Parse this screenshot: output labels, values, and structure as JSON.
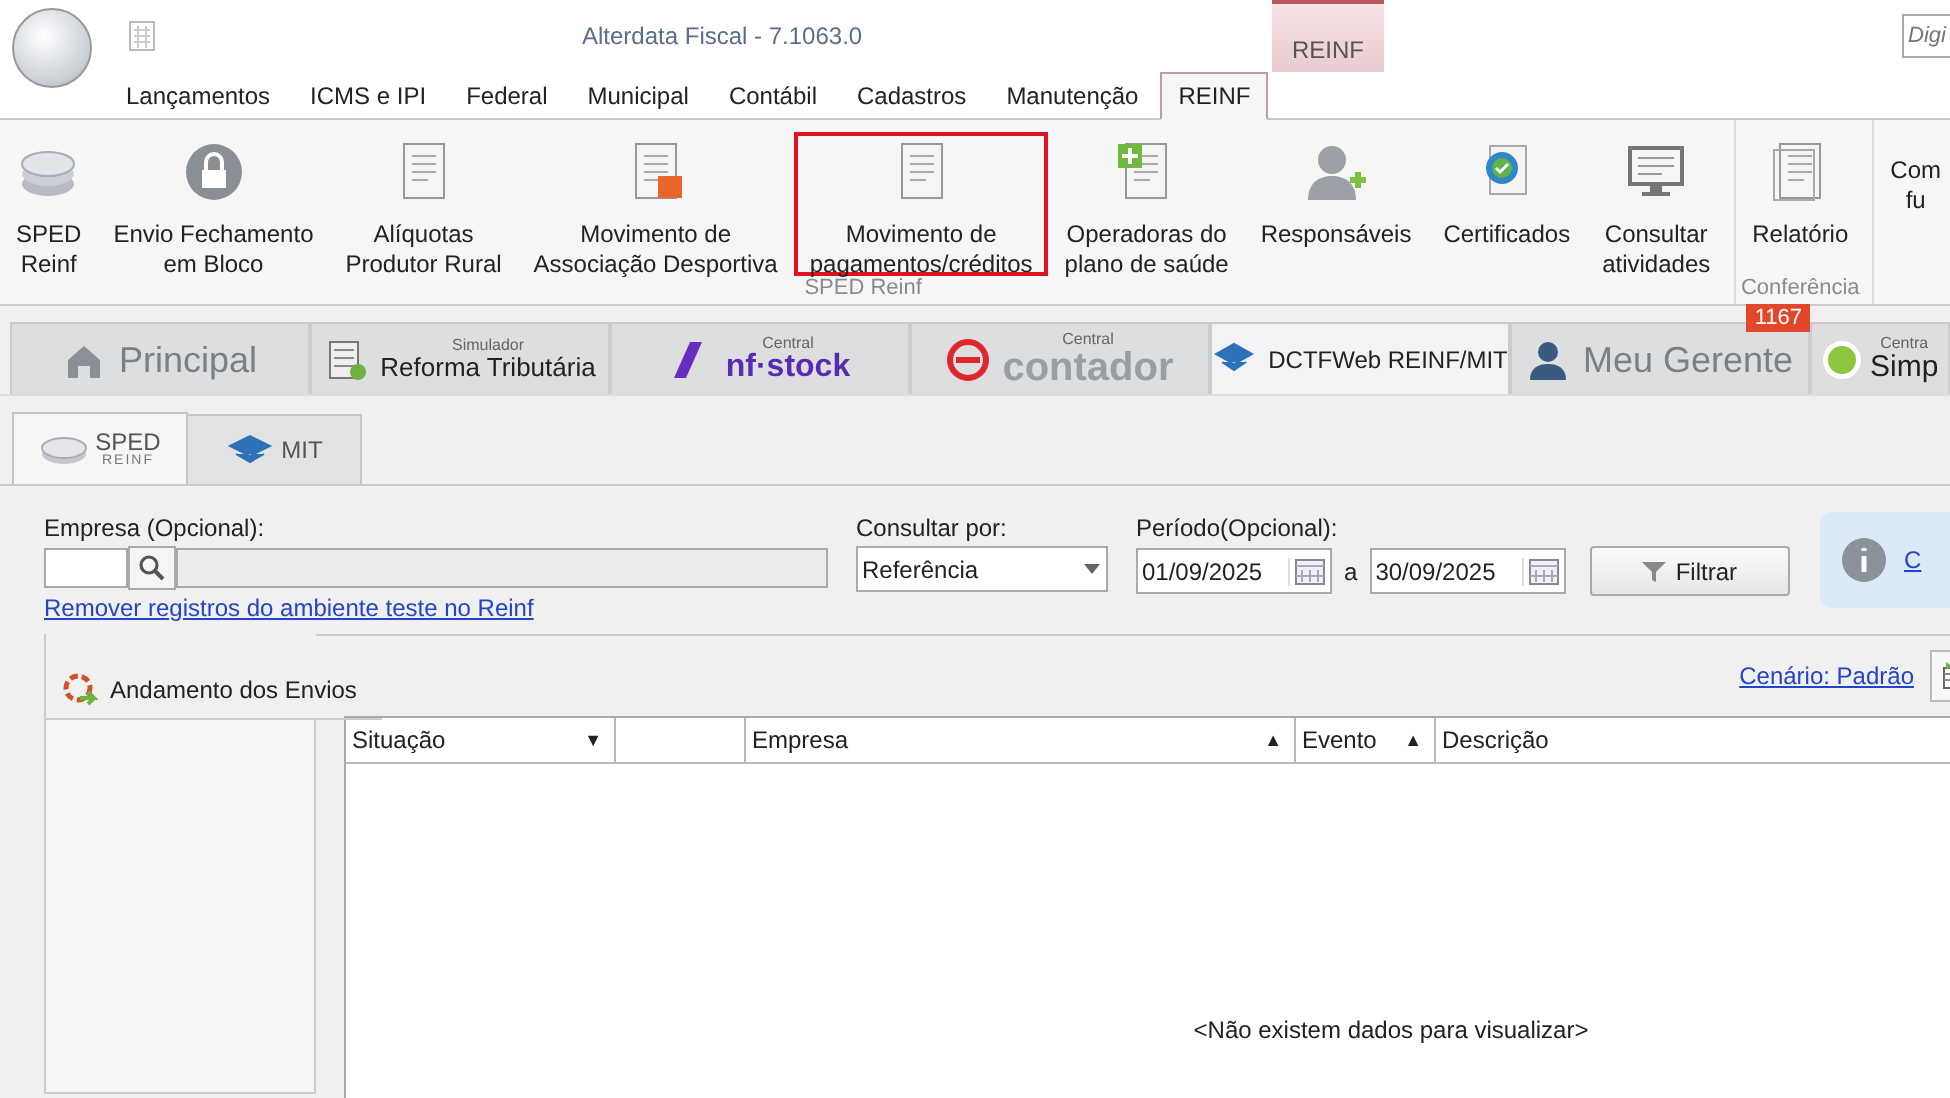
{
  "window": {
    "title": "Alterdata Fiscal - 7.1063.0",
    "context_tab": "REINF",
    "search_placeholder": "Digi"
  },
  "menu_tabs": [
    {
      "label": "Lançamentos",
      "selected": false
    },
    {
      "label": "ICMS e IPI",
      "selected": false
    },
    {
      "label": "Federal",
      "selected": false
    },
    {
      "label": "Municipal",
      "selected": false
    },
    {
      "label": "Contábil",
      "selected": false
    },
    {
      "label": "Cadastros",
      "selected": false
    },
    {
      "label": "Manutenção",
      "selected": false
    },
    {
      "label": "REINF",
      "selected": true
    }
  ],
  "ribbon": {
    "groups": [
      {
        "label": "SPED Reinf",
        "buttons": [
          {
            "kind": "disks",
            "label": [
              "SPED",
              "Reinf"
            ],
            "highlighted": false
          },
          {
            "kind": "lock",
            "label": [
              "Envio Fechamento",
              "em Bloco"
            ],
            "highlighted": false
          },
          {
            "kind": "doc",
            "label": [
              "Alíquotas",
              "Produtor Rural"
            ],
            "highlighted": false
          },
          {
            "kind": "doc-arrows",
            "label": [
              "Movimento de",
              "Associação Desportiva"
            ],
            "highlighted": false
          },
          {
            "kind": "doc-list",
            "label": [
              "Movimento de",
              "pagamentos/créditos"
            ],
            "highlighted": true
          },
          {
            "kind": "doc-plus",
            "label": [
              "Operadoras do",
              "plano de saúde"
            ],
            "highlighted": false
          },
          {
            "kind": "person-plus",
            "label": [
              "Responsáveis"
            ],
            "highlighted": false
          },
          {
            "kind": "certificate",
            "label": [
              "Certificados"
            ],
            "highlighted": false
          },
          {
            "kind": "monitor",
            "label": [
              "Consultar",
              "atividades"
            ],
            "highlighted": false
          }
        ]
      },
      {
        "label": "Conferência",
        "buttons": [
          {
            "kind": "docs",
            "label": [
              "Relatório"
            ],
            "highlighted": false
          }
        ]
      },
      {
        "buttons": [
          {
            "kind": "none",
            "label": [
              "Com",
              "fu"
            ],
            "highlighted": false
          }
        ]
      }
    ]
  },
  "main_tabs": [
    {
      "kind": "home",
      "label": "Principal",
      "selected": false
    },
    {
      "kind": "calculator",
      "small": "Simulador",
      "label": "Reforma Tributária",
      "selected": false
    },
    {
      "kind": "nfstock",
      "small": "Central",
      "label": "nf·stock",
      "selected": false
    },
    {
      "kind": "contador",
      "small": "Central",
      "label": "contador",
      "selected": false
    },
    {
      "kind": "diamond",
      "label": "DCTFWeb REINF/MIT",
      "selected": true
    },
    {
      "kind": "person",
      "label": "Meu Gerente",
      "selected": false,
      "badge": "1167"
    },
    {
      "kind": "s-logo",
      "small": "Centra",
      "label": "Simp",
      "selected": false
    }
  ],
  "sub_tabs": [
    {
      "kind": "disks",
      "label": "SPED",
      "small": "REINF",
      "selected": true
    },
    {
      "kind": "diamond",
      "label": "MIT",
      "selected": false
    }
  ],
  "filters": {
    "empresa_label": "Empresa (Opcional):",
    "remove_link": "Remover registros do ambiente teste no Reinf",
    "consultar_label": "Consultar por:",
    "consultar_value": "Referência",
    "periodo_label": "Período(Opcional):",
    "from": "01/09/2025",
    "to_sep": "a",
    "to": "30/09/2025",
    "filter_button": "Filtrar",
    "info_link": "C"
  },
  "panel": {
    "title": "Andamento dos Envios",
    "scenario_link": "Cenário: Padrão"
  },
  "grid": {
    "columns": [
      {
        "label": "Situação",
        "sort_mark": "▼"
      },
      {},
      {
        "label": "Empresa",
        "sort_mark": "▲"
      },
      {
        "label": "Evento",
        "sort_mark": "▲"
      },
      {
        "label": "Descrição"
      }
    ],
    "empty_text": "<Não existem dados para visualizar>"
  }
}
